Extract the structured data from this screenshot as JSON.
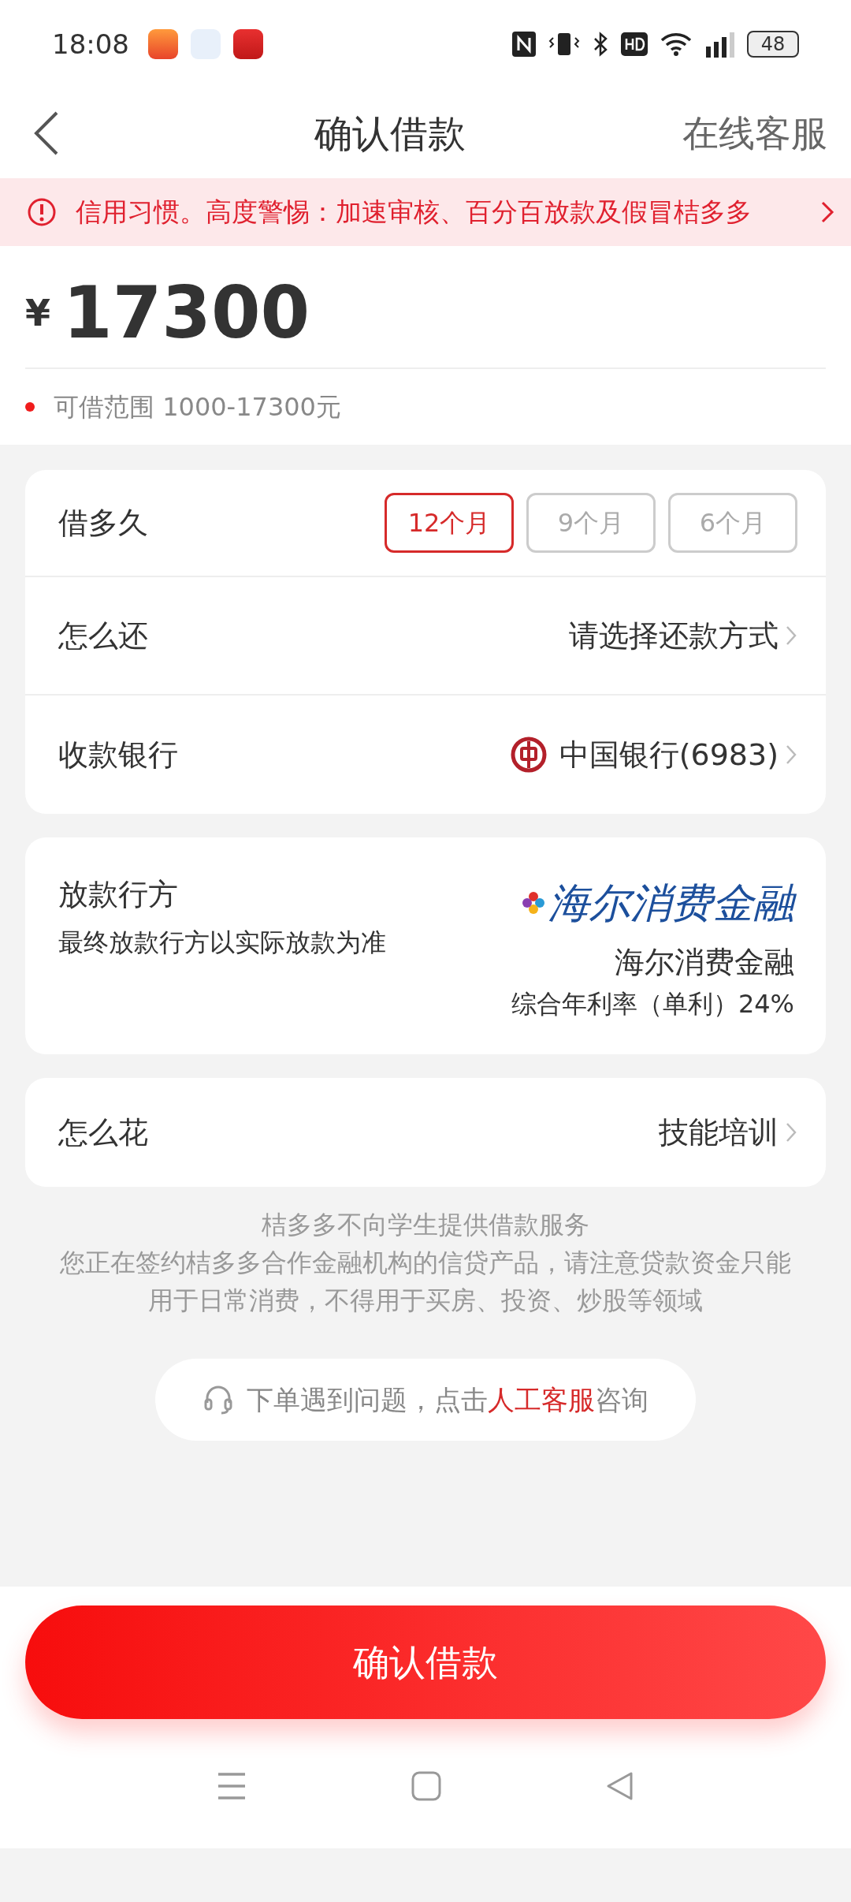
{
  "status_bar": {
    "time": "18:08",
    "battery": "48"
  },
  "header": {
    "title": "确认借款",
    "action": "在线客服"
  },
  "notice": {
    "text": "信用习惯。高度警惕：加速审核、百分百放款及假冒桔多多"
  },
  "amount": {
    "currency": "¥",
    "value": "17300",
    "range": "可借范围 1000-17300元"
  },
  "term": {
    "label": "借多久",
    "options": [
      {
        "label": "12个月",
        "selected": true
      },
      {
        "label": "9个月",
        "selected": false
      },
      {
        "label": "6个月",
        "selected": false
      }
    ]
  },
  "repay": {
    "label": "怎么还",
    "value": "请选择还款方式"
  },
  "bank": {
    "label": "收款银行",
    "value": "中国银行(6983)"
  },
  "lender": {
    "label": "放款行方",
    "note": "最终放款行方以实际放款为准",
    "logo_text": "海尔消费金融",
    "name": "海尔消费金融",
    "rate": "综合年利率（单利）24%"
  },
  "usage": {
    "label": "怎么花",
    "value": "技能培训"
  },
  "disclaimer": [
    "桔多多不向学生提供借款服务",
    "您正在签约桔多多合作金融机构的信贷产品，请注意贷款资金只能用于日常消费，不得用于买房、投资、炒股等领域"
  ],
  "help": {
    "before": "下单遇到问题，点击",
    "link": "人工客服",
    "after": "咨询"
  },
  "submit": "确认借款"
}
